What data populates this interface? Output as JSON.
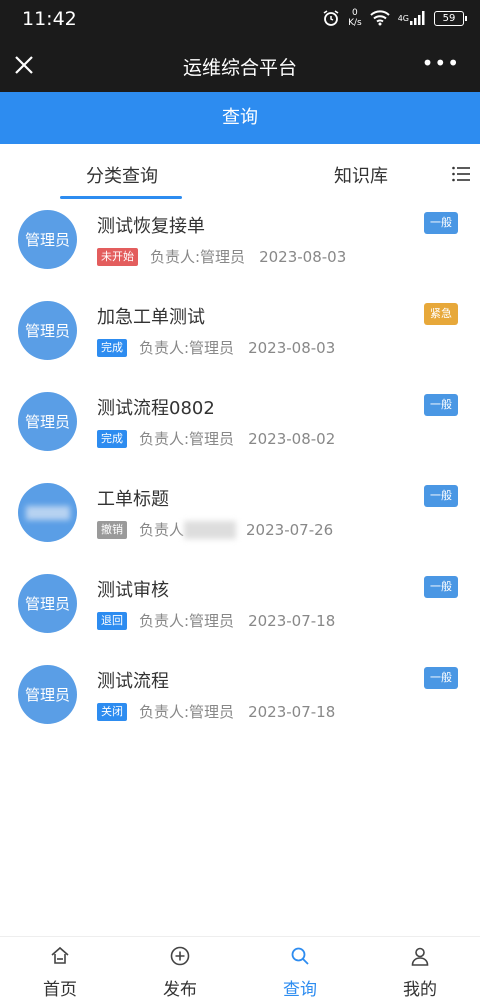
{
  "status_bar": {
    "time": "11:42",
    "netspeed_value": "0",
    "netspeed_unit": "K/s",
    "network": "4G",
    "battery": "59"
  },
  "nav": {
    "title": "运维综合平台",
    "more": "•••"
  },
  "header": {
    "title": "查询"
  },
  "tabs": [
    {
      "label": "分类查询",
      "active": true
    },
    {
      "label": "知识库",
      "active": false
    }
  ],
  "items": [
    {
      "avatar": "管理员",
      "title": "测试恢复接单",
      "status": "未开始",
      "status_color": "#e35d5d",
      "owner": "负责人:管理员",
      "date": "2023-08-03",
      "priority": "一般",
      "priority_color": "#4a97e4"
    },
    {
      "avatar": "管理员",
      "title": "加急工单测试",
      "status": "完成",
      "status_color": "#2d8cf0",
      "owner": "负责人:管理员",
      "date": "2023-08-03",
      "priority": "紧急",
      "priority_color": "#e7a83a"
    },
    {
      "avatar": "管理员",
      "title": "测试流程0802",
      "status": "完成",
      "status_color": "#2d8cf0",
      "owner": "负责人:管理员",
      "date": "2023-08-02",
      "priority": "一般",
      "priority_color": "#4a97e4"
    },
    {
      "avatar": "",
      "title": "工单标题",
      "status": "撤销",
      "status_color": "#9a9a9a",
      "owner": "负责人",
      "date": "2023-07-26",
      "priority": "一般",
      "priority_color": "#4a97e4"
    },
    {
      "avatar": "管理员",
      "title": "测试审核",
      "status": "退回",
      "status_color": "#2d8cf0",
      "owner": "负责人:管理员",
      "date": "2023-07-18",
      "priority": "一般",
      "priority_color": "#4a97e4"
    },
    {
      "avatar": "管理员",
      "title": "测试流程",
      "status": "关闭",
      "status_color": "#2d8cf0",
      "owner": "负责人:管理员",
      "date": "2023-07-18",
      "priority": "一般",
      "priority_color": "#4a97e4"
    }
  ],
  "tab_bar": [
    {
      "label": "首页",
      "icon": "home-icon",
      "active": false
    },
    {
      "label": "发布",
      "icon": "plus-circle-icon",
      "active": false
    },
    {
      "label": "查询",
      "icon": "search-icon",
      "active": true
    },
    {
      "label": "我的",
      "icon": "user-icon",
      "active": false
    }
  ]
}
